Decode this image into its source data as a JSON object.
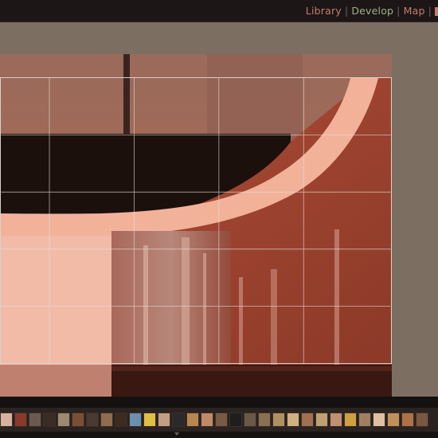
{
  "modules": {
    "items": [
      {
        "label": "Library",
        "color": "#c87a6e"
      },
      {
        "label": "Develop",
        "color": "#9fb08a"
      },
      {
        "label": "Map",
        "color": "#c87a6e"
      }
    ],
    "separator": "|"
  },
  "colors": {
    "workspace": "#7d6e62",
    "topbar": "#1c1716",
    "filmstrip": "#2a2320"
  },
  "filmstrip": {
    "thumbs": [
      "#d7b39f",
      "#8a3a2a",
      "#6b5a50",
      "#3a2c24",
      "#9c8a70",
      "#7a5035",
      "#4a3a30",
      "#8f6c4c",
      "#3d2a20",
      "#6a8fb0",
      "#e0c040",
      "#c0a080",
      "#2a2a2a",
      "#b8864e",
      "#c08a68",
      "#7a5a45",
      "#1e1e1e",
      "#6a5848",
      "#8a7050",
      "#b09060",
      "#d0b080",
      "#a07050",
      "#c0a070",
      "#c09070",
      "#d0a040",
      "#a08060",
      "#e0c0a0",
      "#c09058",
      "#b07048",
      "#7a5840"
    ]
  },
  "icons": {
    "grid": "crop-grid-overlay",
    "arrow": "filmstrip-arrow-icon"
  }
}
